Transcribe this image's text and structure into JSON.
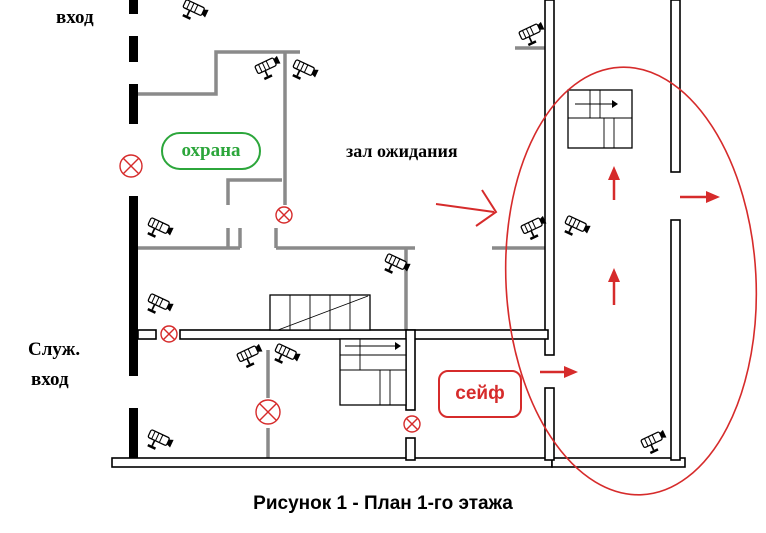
{
  "labels": {
    "entrance": "вход",
    "service_entrance_line1": "Служ.",
    "service_entrance_line2": "вход",
    "security": "охрана",
    "waiting_hall": "зал ожидания",
    "safe": "сейф"
  },
  "caption": "Рисунок 1 - План 1-го этажа",
  "colors": {
    "walls": "#000000",
    "partitions": "#8a8a8a",
    "security_label": "#2ca63b",
    "highlight": "#d62b2b",
    "cameras": "#000000",
    "door_sensors": "#d62b2b"
  },
  "icons": {
    "camera": "surveillance-camera-icon",
    "sensor": "door-sensor-icon",
    "arrow": "direction-arrow-icon",
    "stairs": "staircase-icon"
  }
}
